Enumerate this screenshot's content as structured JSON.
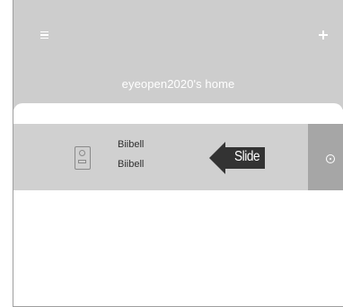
{
  "header": {
    "title": "eyeopen2020's home",
    "menu_icon": "hamburger-menu-icon",
    "add_icon": "plus-icon",
    "background_color": "#cdcdcd"
  },
  "device": {
    "name": "Biibell",
    "subtitle": "Biibell",
    "icon": "doorbell-icon",
    "row_color": "#d0d0d0"
  },
  "hint": {
    "label": "Slide",
    "icon": "left-arrow-icon",
    "color": "#333333"
  },
  "action": {
    "icon": "settings-circle-icon",
    "panel_color": "#a6a6a6"
  }
}
